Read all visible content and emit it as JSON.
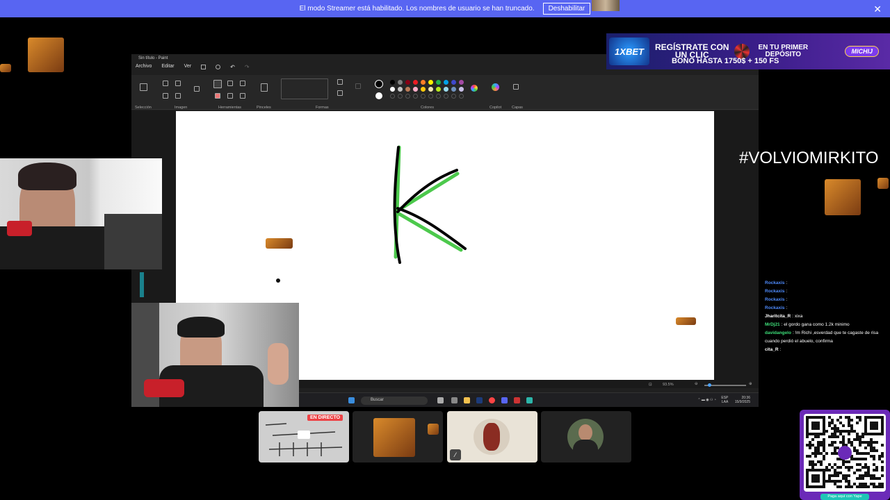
{
  "banner": {
    "message": "El modo Streamer está habilitado. Los nombres de usuario se han truncado.",
    "button": "Deshabilitar",
    "close": "✕"
  },
  "paint": {
    "title": "Sin título - Paint",
    "menu": [
      "Archivo",
      "Editar",
      "Ver"
    ],
    "groups": {
      "seleccion": "Selección",
      "imagen": "Imagen",
      "herramientas": "Herramientas",
      "pinceles": "Pinceles",
      "formas": "Formas",
      "colores": "Colores",
      "copilot": "Copilot",
      "capas": "Capas"
    },
    "zoom": "93.5%",
    "colors": [
      "#000000",
      "#7f7f7f",
      "#880015",
      "#ed1c24",
      "#ff7f27",
      "#fff200",
      "#22b14c",
      "#00a2e8",
      "#3f48cc",
      "#a349a4",
      "#ffffff",
      "#c3c3c3",
      "#b97a57",
      "#ffaec9",
      "#ffc90e",
      "#efe4b0",
      "#b5e61d",
      "#99d9ea",
      "#7092be",
      "#c8bfe7"
    ],
    "letter_color": "#4cc94c"
  },
  "taskbar": {
    "search": "Buscar",
    "lang1": "ESP",
    "lang2": "LAA",
    "time": "20:36",
    "date": "15/9/2025"
  },
  "ad": {
    "brand": "1XBET",
    "line1a": "REGÍSTRATE CON",
    "line1b": "UN CLIC",
    "line2a": "EN TU PRIMER",
    "line2b": "DEPÓSITO",
    "bono": "BONO HASTA 1750$ + 150 FS",
    "code": "MICHIJ"
  },
  "hashtag": "#VOLVIOMIRKITO",
  "chat": [
    {
      "user": "Rockaxis",
      "text": ":",
      "color": "#4f8cff"
    },
    {
      "user": "Rockaxis",
      "text": ":",
      "color": "#4f8cff"
    },
    {
      "user": "Rockaxis",
      "text": ":",
      "color": "#4f8cff"
    },
    {
      "user": "Rockaxis",
      "text": ":",
      "color": "#4f8cff"
    },
    {
      "user": "Jharitcita_R",
      "text": ": xixa",
      "color": "#ffffff"
    },
    {
      "user": "MrDj21",
      "text": ": el gordo gana como 1.2k minimo",
      "color": "#3ee07a"
    },
    {
      "user": "davidangelo",
      "text": ": !m Richi ,esverdad que te cagaste de risa cuando perdió el abuelo, confirma",
      "color": "#3ee07a"
    },
    {
      "user": "cita_R",
      "text": ":",
      "color": "#ffffff"
    }
  ],
  "participants": {
    "live_label": "EN DIRECTO"
  },
  "qr": {
    "caption": "Paga aquí con Yape"
  }
}
